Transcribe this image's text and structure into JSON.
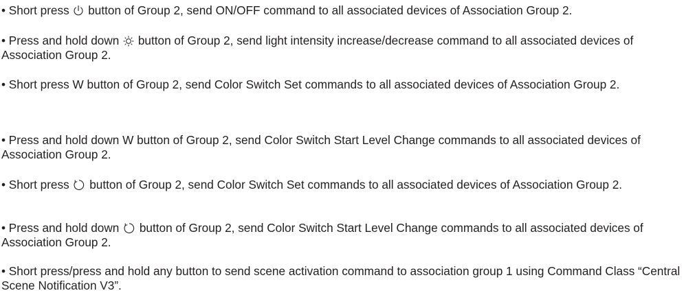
{
  "paragraphs": {
    "p1": {
      "a": "• Short press ",
      "icon": "power-icon",
      "b": " button of Group 2, send ON/OFF command to all associated devices of Association Group 2."
    },
    "p2": {
      "a": "• Press and hold down ",
      "icon": "sun-brightness-icon",
      "b": " button of Group 2, send light intensity increase/decrease command to all associated devices of Association Group 2."
    },
    "p3": {
      "a": "• Short press W button of Group 2, send Color Switch Set commands to all associated devices of Association Group 2."
    },
    "p4": {
      "a": "• Press and hold down W button of Group 2, send Color Switch Start Level Change commands to all associated devices of Association Group 2."
    },
    "p5": {
      "a": "• Short press ",
      "icon": "color-wheel-icon",
      "b": " button of Group 2, send Color Switch Set commands to all associated devices of Association Group 2."
    },
    "p6": {
      "a": "• Press and hold down ",
      "icon": "color-wheel-icon",
      "b": " button of Group 2, send Color Switch Start Level Change commands to all associated devices of Association Group 2."
    },
    "p7": {
      "a": "• Short press/press and hold any button to send scene activation command to association group 1 using Command Class “Central Scene Notification V3”."
    }
  }
}
